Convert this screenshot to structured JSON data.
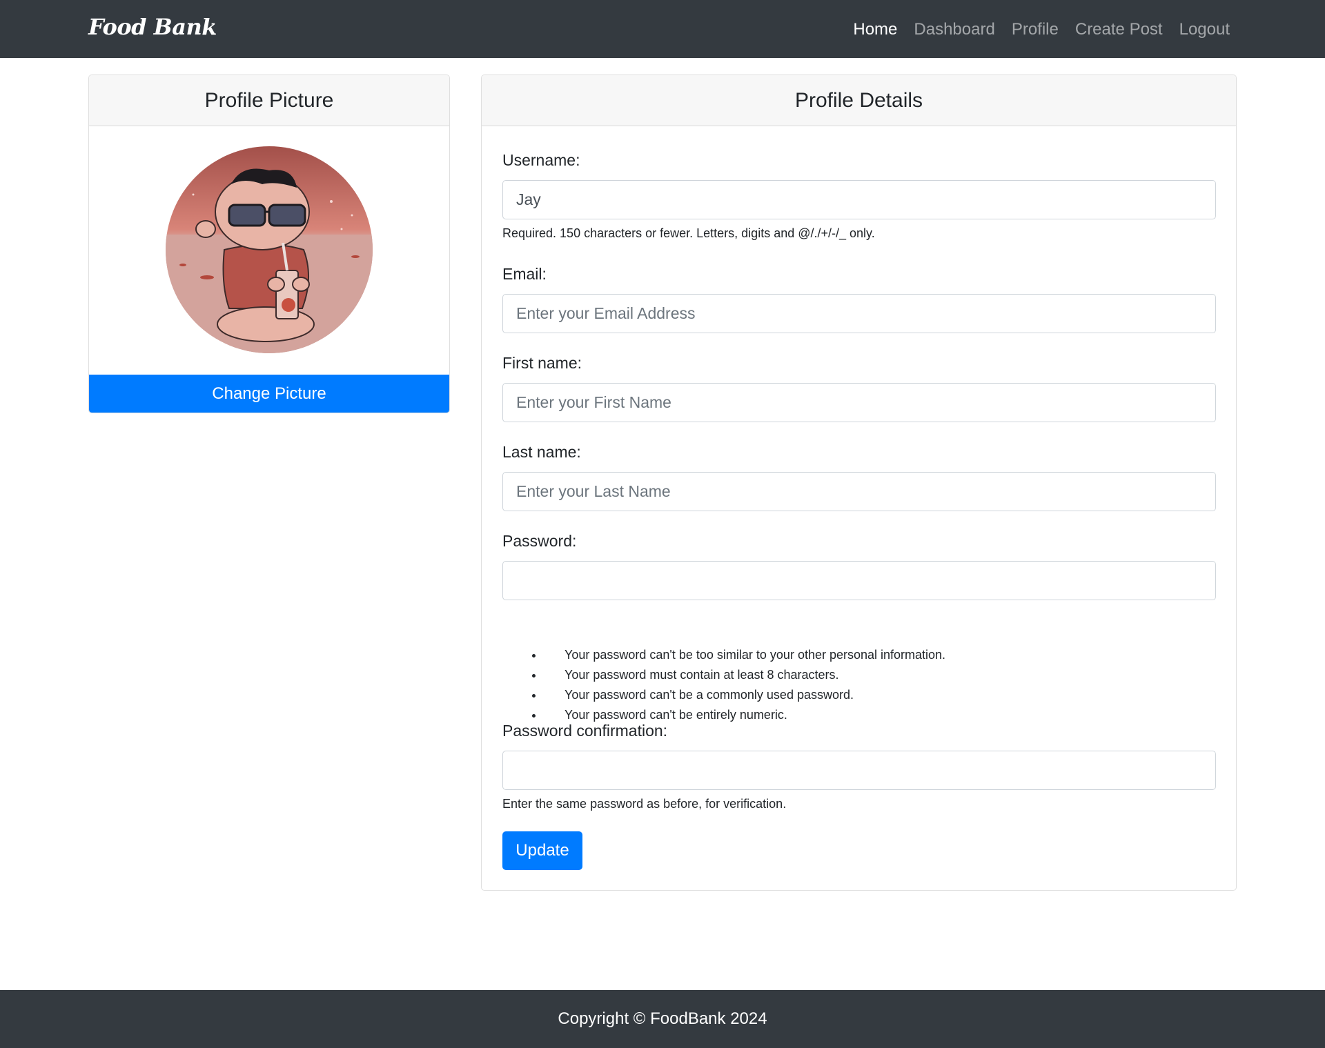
{
  "navbar": {
    "brand": "Food Bank",
    "links": [
      "Home",
      "Dashboard",
      "Profile",
      "Create Post",
      "Logout"
    ],
    "active": "Home"
  },
  "picture_card": {
    "title": "Profile Picture",
    "change_button": "Change Picture"
  },
  "details_card": {
    "title": "Profile Details",
    "username": {
      "label": "Username:",
      "value": "Jay",
      "help": "Required. 150 characters or fewer. Letters, digits and @/./+/-/_ only."
    },
    "email": {
      "label": "Email:",
      "placeholder": "Enter your Email Address"
    },
    "first_name": {
      "label": "First name:",
      "placeholder": "Enter your First Name"
    },
    "last_name": {
      "label": "Last name:",
      "placeholder": "Enter your Last Name"
    },
    "password": {
      "label": "Password:",
      "rules": [
        "Your password can't be too similar to your other personal information.",
        "Your password must contain at least 8 characters.",
        "Your password can't be a commonly used password.",
        "Your password can't be entirely numeric."
      ]
    },
    "password_confirmation": {
      "label": "Password confirmation:",
      "help": "Enter the same password as before, for verification."
    },
    "update_button": "Update"
  },
  "footer": {
    "text": "Copyright © FoodBank 2024"
  },
  "colors": {
    "navbar": "#343a40",
    "primary": "#007bff",
    "header_bg": "#f7f7f7"
  }
}
